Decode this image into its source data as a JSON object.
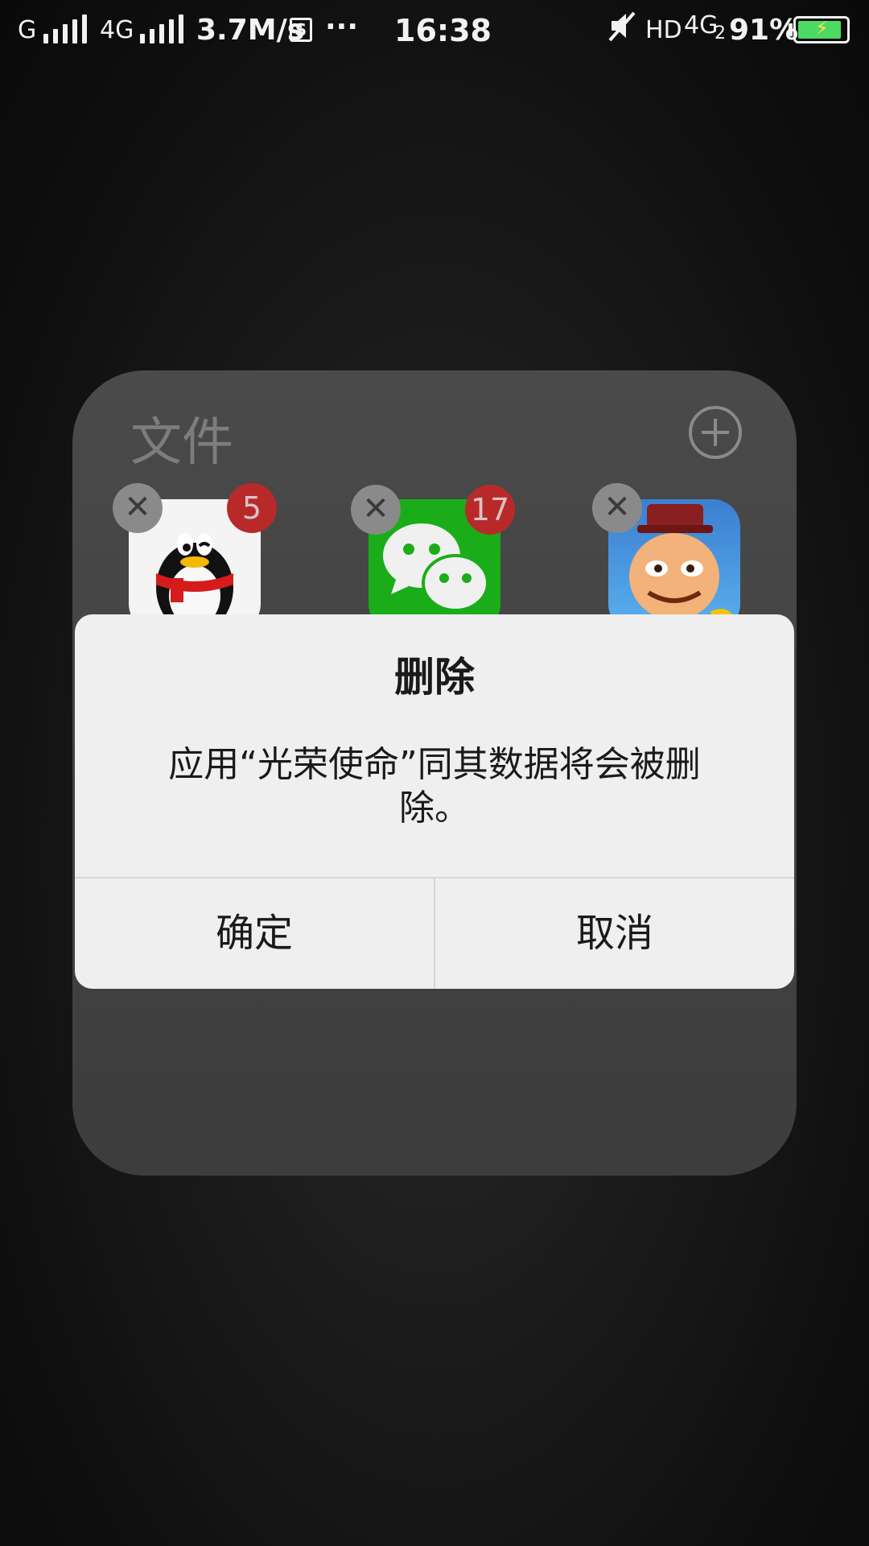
{
  "status_bar": {
    "carrier1": "G",
    "carrier2": "4G",
    "speed": "3.7M/s",
    "sim_label": "S",
    "more": "···",
    "time": "16:38",
    "hd": "HD",
    "network": "4G",
    "network_sub": "2",
    "battery_percent": "91%",
    "battery_level": 0.91
  },
  "folder": {
    "title": "文件",
    "apps": [
      {
        "name": "QQ",
        "badge": "5"
      },
      {
        "name": "WeChat",
        "badge": "17"
      },
      {
        "name": "光荣使命",
        "badge": ""
      }
    ]
  },
  "dialog": {
    "title": "删除",
    "message": "应用“光荣使命”同其数据将会被删除。",
    "confirm_label": "确定",
    "cancel_label": "取消"
  },
  "colors": {
    "dialog_bg": "#efefef",
    "badge": "#b82a2a",
    "wechat_green": "#1aad19",
    "battery_green": "#4cd964"
  }
}
